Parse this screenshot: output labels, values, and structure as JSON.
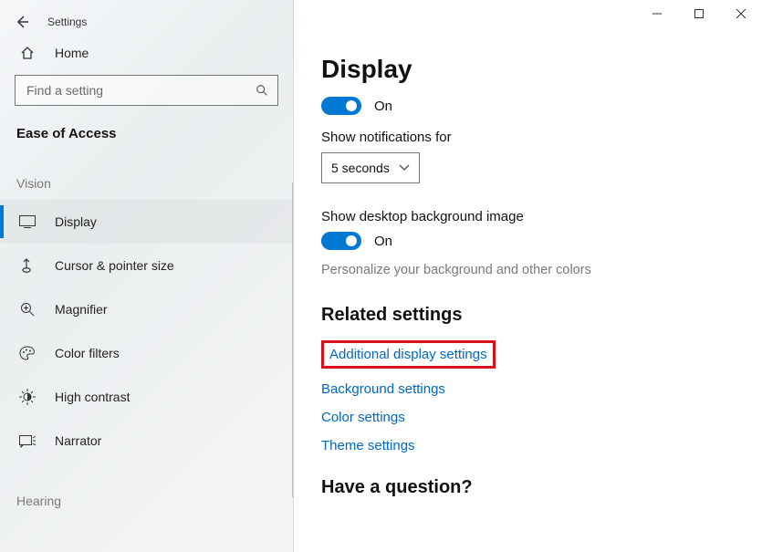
{
  "window": {
    "title": "Settings"
  },
  "search": {
    "placeholder": "Find a setting"
  },
  "sidebar": {
    "home": "Home",
    "category": "Ease of Access",
    "group_vision": "Vision",
    "items": [
      {
        "label": "Display"
      },
      {
        "label": "Cursor & pointer size"
      },
      {
        "label": "Magnifier"
      },
      {
        "label": "Color filters"
      },
      {
        "label": "High contrast"
      },
      {
        "label": "Narrator"
      }
    ],
    "group_hearing": "Hearing"
  },
  "page": {
    "title": "Display",
    "toggle1_state": "On",
    "notifications_label": "Show notifications for",
    "notifications_value": "5 seconds",
    "desktop_bg_label": "Show desktop background image",
    "toggle2_state": "On",
    "personalize_hint": "Personalize your background and other colors",
    "related_title": "Related settings",
    "links": {
      "additional": "Additional display settings",
      "background": "Background settings",
      "color": "Color settings",
      "theme": "Theme settings"
    },
    "question_title": "Have a question?"
  }
}
